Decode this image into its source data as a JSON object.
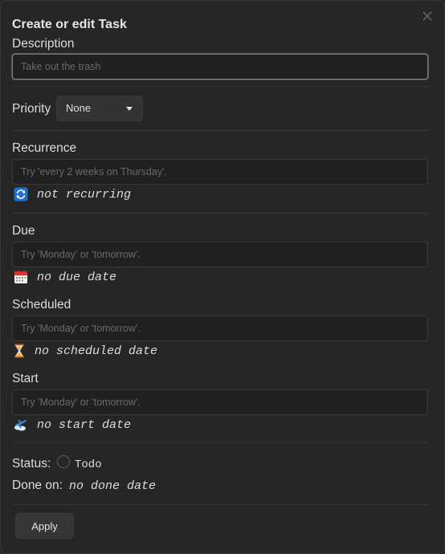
{
  "modal": {
    "title": "Create or edit Task",
    "close_icon": "close-icon"
  },
  "description": {
    "label": "Description",
    "value": "",
    "placeholder": "Take out the trash"
  },
  "priority": {
    "label": "Priority",
    "selected": "None"
  },
  "recurrence": {
    "label": "Recurrence",
    "placeholder": "Try 'every 2 weeks on Thursday'.",
    "icon": "repeat-icon",
    "status": "not recurring"
  },
  "due": {
    "label": "Due",
    "placeholder": "Try 'Monday' or 'tomorrow'.",
    "icon": "calendar-icon",
    "status": "no due date"
  },
  "scheduled": {
    "label": "Scheduled",
    "placeholder": "Try 'Monday' or 'tomorrow'.",
    "icon": "hourglass-icon",
    "status": "no scheduled date"
  },
  "start": {
    "label": "Start",
    "placeholder": "Try 'Monday' or 'tomorrow'.",
    "icon": "airplane-departure-icon",
    "status": "no start date"
  },
  "status": {
    "label": "Status:",
    "value": "Todo"
  },
  "done_on": {
    "label": "Done on:",
    "value": "no done date"
  },
  "apply_button": {
    "label": "Apply"
  },
  "colors": {
    "background": "#262626",
    "input_bg": "#202020",
    "button_bg": "#363636",
    "text": "#dcddde",
    "placeholder": "#6a6a6a",
    "repeat_icon_blue": "#1f6fd1",
    "calendar_red": "#d9332b",
    "hourglass_sand": "#f2a33a"
  }
}
